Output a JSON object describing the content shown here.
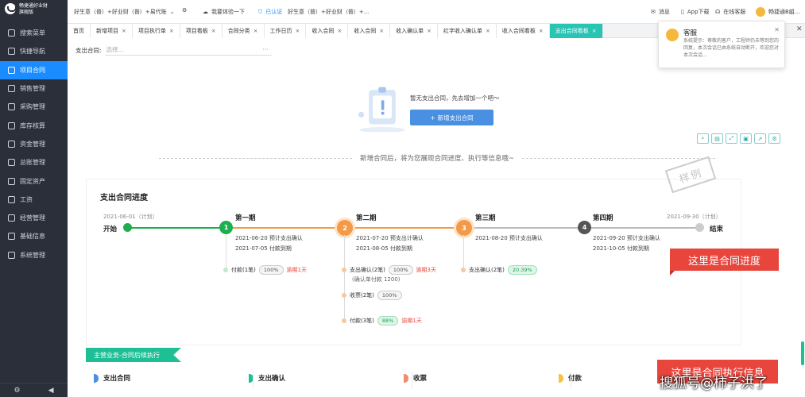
{
  "sidebar": {
    "logo_text": "畅捷通好业财",
    "logo_sub": "旗舰版",
    "items": [
      {
        "label": "搜索菜单",
        "icon": "search-icon"
      },
      {
        "label": "快捷导航",
        "icon": "home-icon"
      },
      {
        "label": "项目合同",
        "icon": "contract-icon"
      },
      {
        "label": "销售管理",
        "icon": "sales-icon"
      },
      {
        "label": "采购管理",
        "icon": "cart-icon"
      },
      {
        "label": "库存核算",
        "icon": "inventory-icon"
      },
      {
        "label": "资金管理",
        "icon": "money-icon"
      },
      {
        "label": "总账管理",
        "icon": "ledger-icon"
      },
      {
        "label": "固定资产",
        "icon": "asset-icon"
      },
      {
        "label": "工资",
        "icon": "salary-icon"
      },
      {
        "label": "经营管理",
        "icon": "chart-icon"
      },
      {
        "label": "基础信息",
        "icon": "info-icon"
      },
      {
        "label": "系统管理",
        "icon": "settings-icon"
      }
    ],
    "active_index": 2
  },
  "topbar": {
    "tenant1": "好生意（普）+好业财（普）+易代账",
    "try_label": "我要体验一下",
    "certified": "已认证",
    "tenant2": "好生意（普）+好业财（普）+...",
    "msg_label": "消息",
    "app_label": "App下载",
    "service_label": "在线客服",
    "user_label": "畅捷通B組..."
  },
  "tabs": [
    {
      "label": "首页",
      "closable": false
    },
    {
      "label": "新增项目",
      "closable": true
    },
    {
      "label": "项目执行单",
      "closable": true
    },
    {
      "label": "项目看板",
      "closable": true
    },
    {
      "label": "合同分类",
      "closable": true
    },
    {
      "label": "工作日历",
      "closable": true
    },
    {
      "label": "收入合同",
      "closable": true
    },
    {
      "label": "收入合同",
      "closable": true
    },
    {
      "label": "收入确认单",
      "closable": true
    },
    {
      "label": "红字收入确认单",
      "closable": true
    },
    {
      "label": "收入合同看板",
      "closable": true
    },
    {
      "label": "支出合同看板",
      "closable": true,
      "active": true
    }
  ],
  "filter": {
    "label": "支出合同:",
    "placeholder": "选择..."
  },
  "empty": {
    "text": "暂无支出合同，先去增加一个吧～",
    "button": "新增支出合同"
  },
  "intro_text": "新增合同后，将为您展现合同进度、执行等信息哦~",
  "stamp_text": "样例",
  "progress": {
    "title": "支出合同进度",
    "start": {
      "date": "2021-06-01（计划）",
      "label": "开始"
    },
    "end": {
      "date": "2021-09-30（计划）",
      "label": "结束"
    },
    "milestones": [
      {
        "num": "1",
        "label": "第一期",
        "lines": [
          "2021-06-20 预计支出确认",
          "2021-07-05 付款到期"
        ]
      },
      {
        "num": "2",
        "label": "第二期",
        "lines": [
          "2021-07-20 预支出计确认",
          "2021-08-05 付款到期"
        ]
      },
      {
        "num": "3",
        "label": "第三期",
        "lines": [
          "2021-08-20 预计支出确认"
        ]
      },
      {
        "num": "4",
        "label": "第四期",
        "lines": [
          "2021-09-20 预计支出确认",
          "2021-10-05 付款到期"
        ]
      }
    ],
    "subitems": {
      "m1_pay": {
        "label": "付款(1笔)",
        "pct": "100%",
        "late": "逾期1天"
      },
      "m2_confirm": {
        "label": "支出确认(2笔)",
        "pct": "100%",
        "late": "逾期3天",
        "note": "(确认单付款 1200)"
      },
      "m2_invoice": {
        "label": "收票(2笔)",
        "pct": "100%"
      },
      "m2_pay": {
        "label": "付款(3笔)",
        "pct": "88%",
        "late": "逾期1天"
      },
      "m3_confirm": {
        "label": "支出确认(2笔)",
        "pct": "20.39%"
      }
    },
    "callout": "这里是合同进度"
  },
  "execution": {
    "header": "主营业务-合同后续执行",
    "cols": [
      "支出合同",
      "支出确认",
      "收票",
      "付款"
    ],
    "callout": "这里是合同执行信息"
  },
  "service_popup": {
    "title": "客服",
    "message": "系统提示：尊敬的客户，工程师仍未等到您的回复，本次会话已由系统自动断开，欢迎您对本次会话..."
  },
  "watermark": "搜狐号@柿子洪了",
  "colors": {
    "accent": "#1a8cff",
    "active_tab": "#28c4b4",
    "done": "#1fae4f",
    "in_progress": "#f39a4a",
    "pending": "#555555",
    "callout": "#e8453c"
  }
}
